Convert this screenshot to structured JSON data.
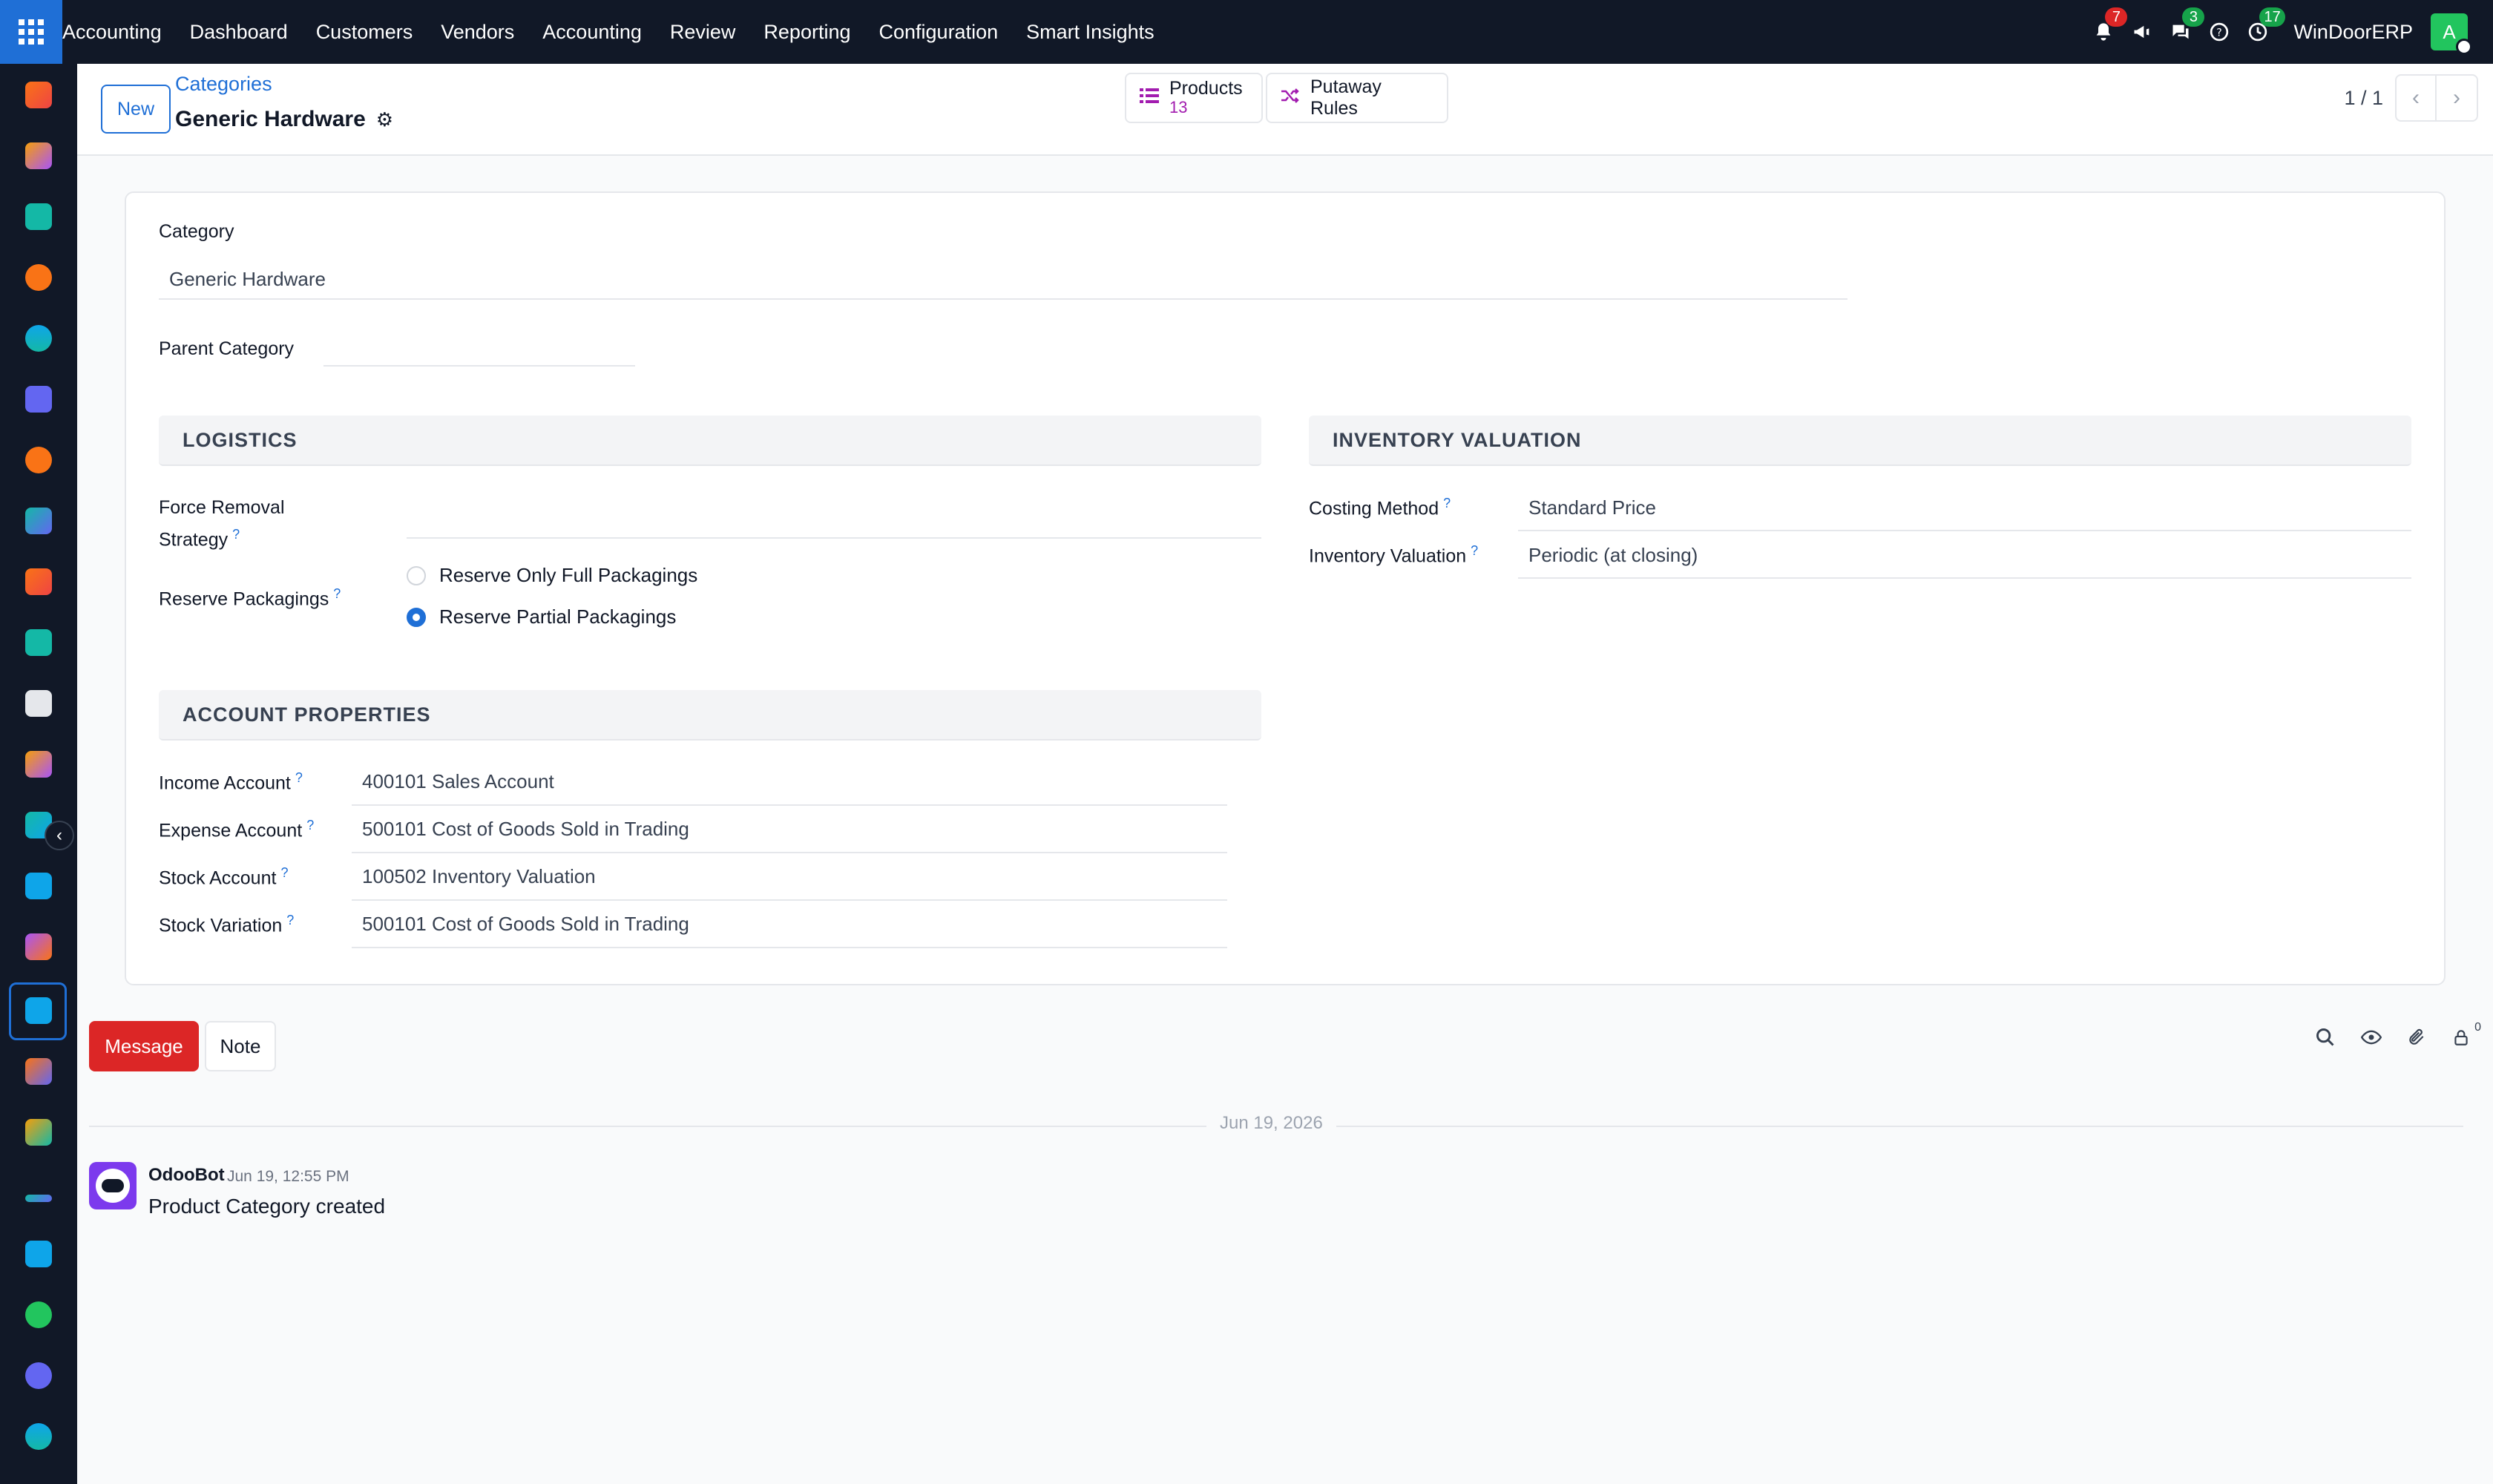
{
  "navbar": {
    "app_name": "Accounting",
    "menu": [
      "Dashboard",
      "Customers",
      "Vendors",
      "Accounting",
      "Review",
      "Reporting",
      "Configuration",
      "Smart Insights"
    ],
    "notifications_count": "7",
    "messages_count": "3",
    "activities_count": "17",
    "company": "WinDoorERP",
    "user_initial": "A"
  },
  "control_panel": {
    "new_label": "New",
    "breadcrumb": "Categories",
    "record_title": "Generic Hardware",
    "smart_buttons": {
      "products_label": "Products",
      "products_count": "13",
      "putaway_label": "Putaway Rules"
    },
    "pager": "1 / 1"
  },
  "form": {
    "category_label": "Category",
    "category_value": "Generic Hardware",
    "parent_label": "Parent Category",
    "parent_value": "",
    "logistics": {
      "title": "LOGISTICS",
      "force_removal_label_1": "Force Removal",
      "force_removal_label_2": "Strategy",
      "force_removal_value": "",
      "reserve_label": "Reserve Packagings",
      "option_full": "Reserve Only Full Packagings",
      "option_partial": "Reserve Partial Packagings",
      "selected": "Reserve Partial Packagings"
    },
    "valuation": {
      "title": "INVENTORY VALUATION",
      "costing_label": "Costing Method",
      "costing_value": "Standard Price",
      "valuation_label": "Inventory Valuation",
      "valuation_value": "Periodic (at closing)"
    },
    "accounts": {
      "title": "ACCOUNT PROPERTIES",
      "income_label": "Income Account",
      "income_value": "400101 Sales Account",
      "expense_label": "Expense Account",
      "expense_value": "500101 Cost of Goods Sold in Trading",
      "stock_label": "Stock Account",
      "stock_value": "100502 Inventory Valuation",
      "variation_label": "Stock Variation",
      "variation_value": "500101 Cost of Goods Sold in Trading"
    },
    "help_mark": "?"
  },
  "chatter": {
    "message_label": "Message",
    "note_label": "Note",
    "followers_count": "0",
    "date_separator": "Jun 19, 2026",
    "messages": [
      {
        "author": "OdooBot",
        "time": "Jun 19, 12:55 PM",
        "body": "Product Category created"
      }
    ]
  },
  "colors": {
    "primary": "#1f6fd6",
    "navbar": "#111827",
    "danger": "#dc2626",
    "success": "#16a34a",
    "products_count": "#a21caf"
  },
  "icons": [
    "apps-grid-icon",
    "bell-icon",
    "megaphone-icon",
    "chat-icon",
    "help-icon",
    "clock-icon",
    "gear-icon",
    "list-icon",
    "shuffle-icon",
    "chevron-left-icon",
    "chevron-right-icon",
    "search-icon",
    "eye-icon",
    "paperclip-icon",
    "follower-icon"
  ]
}
